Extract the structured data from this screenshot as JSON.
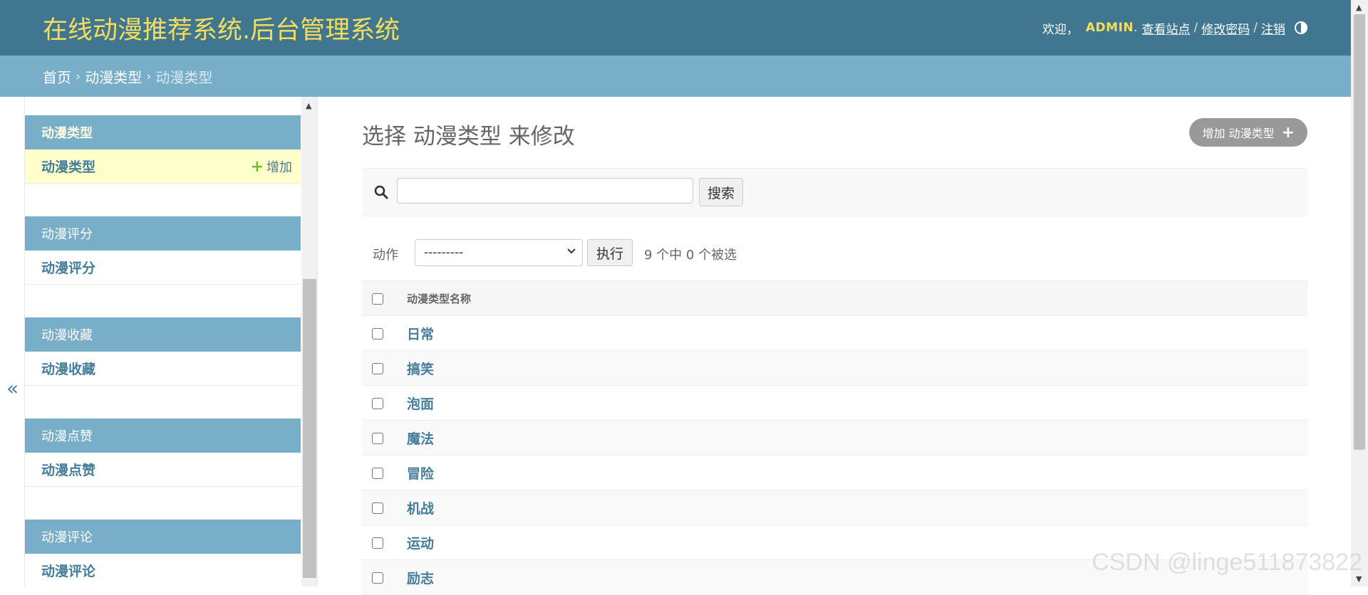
{
  "header": {
    "brand": "在线动漫推荐系统.后台管理系统",
    "welcome": "欢迎，",
    "username": "ADMIN",
    "view_site": "查看站点",
    "change_password": "修改密码",
    "logout": "注销",
    "separator": "/",
    "theme_icon": "half-circle-contrast-icon"
  },
  "breadcrumbs": {
    "home": "首页",
    "app": "动漫类型",
    "current": "动漫类型",
    "arrow": "›"
  },
  "nav_toggle": "«",
  "sidebar": {
    "modules": [
      {
        "caption": "动漫类型",
        "item": "动漫类型",
        "add_label": "增加",
        "active": true
      },
      {
        "caption": "动漫评分",
        "item": "动漫评分"
      },
      {
        "caption": "动漫收藏",
        "item": "动漫收藏"
      },
      {
        "caption": "动漫点赞",
        "item": "动漫点赞"
      },
      {
        "caption": "动漫评论",
        "item": "动漫评论"
      }
    ]
  },
  "main": {
    "title": "选择 动漫类型 来修改",
    "add_button": "增加 动漫类型",
    "search": {
      "value": "",
      "placeholder": "",
      "button": "搜索"
    },
    "actions": {
      "label": "动作",
      "selected": "---------",
      "go_button": "执行",
      "counter": "9 个中 0 个被选"
    },
    "table": {
      "column_header": "动漫类型名称",
      "rows": [
        "日常",
        "搞笑",
        "泡面",
        "魔法",
        "冒险",
        "机战",
        "运动",
        "励志"
      ]
    }
  },
  "watermark": "CSDN @linge511873822",
  "colors": {
    "header_bg": "#417690",
    "brand": "#f5dd5d",
    "breadcrumb_bg": "#79aec8",
    "module_caption_bg": "#79aec8",
    "link": "#447e9b",
    "current_row_bg": "#ffffcc",
    "add_green": "#70bf2b"
  }
}
